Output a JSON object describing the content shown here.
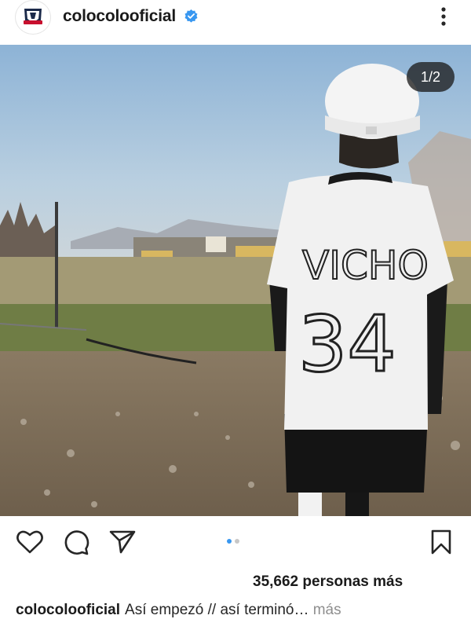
{
  "post": {
    "username": "colocolooficial",
    "verified": true,
    "counter": "1/2",
    "likes": "35,662 personas más",
    "caption_user": "colocolooficial",
    "caption_text": "Así empezó // así terminó",
    "caption_ellipsis": "…",
    "caption_more": "más",
    "jersey_name": "VICHO",
    "jersey_number": "34"
  },
  "icons": {
    "more": "more-vertical-icon",
    "like": "heart-icon",
    "comment": "comment-icon",
    "share": "send-icon",
    "save": "bookmark-icon"
  },
  "colors": {
    "accent_verified": "#3897f0",
    "active_dot": "#3897f0",
    "inactive_dot": "#c7c7c7",
    "text": "#262626",
    "muted": "#8e8e8e"
  }
}
